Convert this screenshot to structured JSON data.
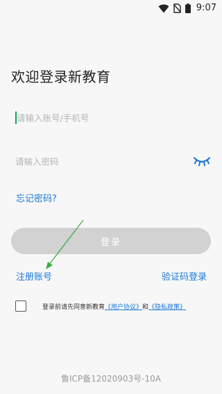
{
  "status_bar": {
    "time": "9:07",
    "icons": [
      "wifi-icon",
      "no-sim-icon",
      "battery-icon"
    ]
  },
  "login": {
    "title": "欢迎登录新教育",
    "phone_placeholder": "请输入账号/手机号",
    "phone_value": "",
    "password_placeholder": "请输入密码",
    "password_value": "",
    "password_toggle_icon": "eye-closed-icon",
    "forgot_password": "忘记密码?",
    "login_button": "登录",
    "register": "注册账号",
    "sms_login": "验证码登录"
  },
  "agreement": {
    "prefix": "登录前请先同意新教育",
    "user_agreement": "《用户协议》",
    "and": "和",
    "privacy_policy": "《隐私政策》",
    "checked": false
  },
  "footer": {
    "icp": "鲁ICP备12020903号-10A"
  },
  "annotation": {
    "arrow_color": "#3cb043",
    "points_to": "register"
  },
  "colors": {
    "link": "#1b78d4",
    "button_disabled": "#d2d2d2",
    "caret": "#17a05d",
    "background": "#f7f7f7"
  }
}
